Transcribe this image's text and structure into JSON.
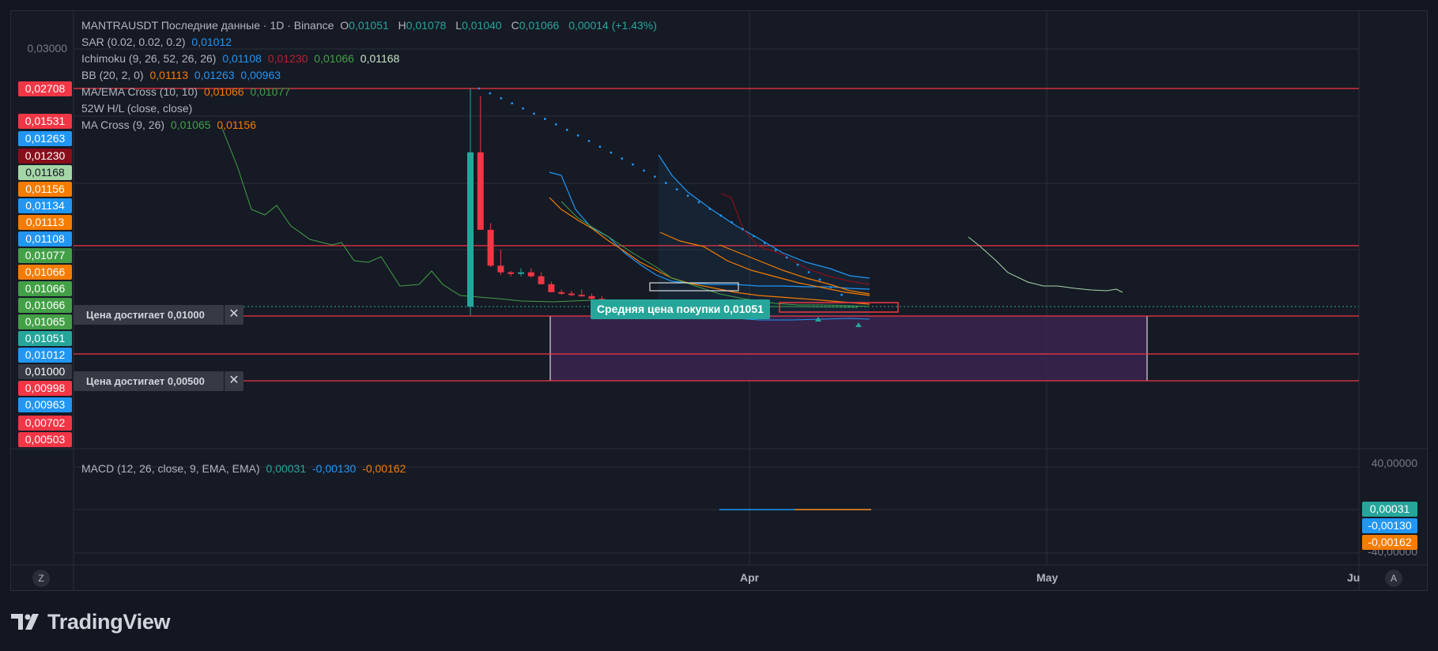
{
  "brand": {
    "name": "TradingView",
    "logo_icon": "tradingview-logo-icon"
  },
  "legend": {
    "main": {
      "symbol": "MANTRAUSDT Последние данные · 1D · Binance",
      "o_label": "O",
      "o": "0,01051",
      "h_label": "H",
      "h": "0,01078",
      "l_label": "L",
      "l": "0,01040",
      "c_label": "C",
      "c": "0,01066",
      "change": "0,00014 (+1.43%)"
    },
    "sar": {
      "label": "SAR (0.02, 0.02, 0.2)",
      "v1": "0,01012"
    },
    "ichimoku": {
      "label": "Ichimoku (9, 26, 52, 26, 26)",
      "v1": "0,01108",
      "v2": "0,01230",
      "v3": "0,01066",
      "v4": "0,01168"
    },
    "bb": {
      "label": "BB (20, 2, 0)",
      "v1": "0,01113",
      "v2": "0,01263",
      "v3": "0,00963"
    },
    "maema": {
      "label": "MA/EMA Cross (10, 10)",
      "v1": "0,01066",
      "v2": "0,01077"
    },
    "hl52": {
      "label": "52W H/L (close, close)"
    },
    "macross": {
      "label": "MA Cross (9, 26)",
      "v1": "0,01065",
      "v2": "0,01156"
    },
    "macd": {
      "label": "MACD (12, 26, close, 9, EMA, EMA)",
      "v1": "0,00031",
      "v2": "-0,00130",
      "v3": "-0,00162"
    }
  },
  "left_scale": {
    "ticks": [
      {
        "label": "0,03000",
        "value": 0.03
      }
    ],
    "tags": [
      {
        "label": "0,02708",
        "color": "#f23645"
      },
      {
        "label": "0,01531",
        "color": "#f23645"
      },
      {
        "label": "0,01263",
        "color": "#2196f3"
      },
      {
        "label": "0,01230",
        "color": "#880e1a"
      },
      {
        "label": "0,01168",
        "color": "#a5d6a7",
        "text": "#131722"
      },
      {
        "label": "0,01156",
        "color": "#f57c00"
      },
      {
        "label": "0,01134",
        "color": "#2196f3"
      },
      {
        "label": "0,01113",
        "color": "#f57c00"
      },
      {
        "label": "0,01108",
        "color": "#2196f3"
      },
      {
        "label": "0,01077",
        "color": "#43a047"
      },
      {
        "label": "0,01066",
        "color": "#f57c00"
      },
      {
        "label": "0,01066",
        "color": "#43a047"
      },
      {
        "label": "0,01066",
        "color": "#43a047"
      },
      {
        "label": "0,01065",
        "color": "#43a047"
      },
      {
        "label": "0,01051",
        "color": "#26a69a"
      },
      {
        "label": "0,01012",
        "color": "#2196f3"
      },
      {
        "label": "0,01000",
        "color": "#363a45"
      },
      {
        "label": "0,00998",
        "color": "#f23645"
      },
      {
        "label": "0,00963",
        "color": "#2196f3"
      },
      {
        "label": "0,00702",
        "color": "#f23645"
      },
      {
        "label": "0,00503",
        "color": "#f23645"
      }
    ]
  },
  "right_scale": {
    "ticks": [
      {
        "label": "40,00000"
      },
      {
        "label": "-40,00000"
      }
    ],
    "tags": [
      {
        "label": "0,00031",
        "color": "#26a69a"
      },
      {
        "label": "-0,00130",
        "color": "#2196f3"
      },
      {
        "label": "-0,00162",
        "color": "#f57c00"
      }
    ]
  },
  "alerts": [
    {
      "text": "Цена достигает 0,01000",
      "close_icon": "close-icon"
    },
    {
      "text": "Цена достигает 0,00500",
      "close_icon": "close-icon"
    }
  ],
  "avg_price_label": "Средняя цена покупки 0,01051",
  "x_axis": {
    "labels": [
      "Apr",
      "May",
      "Ju"
    ]
  },
  "corners": {
    "left": "Z",
    "right": "A"
  },
  "colors": {
    "up": "#26a69a",
    "down": "#f23645",
    "sar": "#2196f3",
    "bb": "#2196f3",
    "ema": "#f57c00",
    "purple_box": "#4a2a5a",
    "line_red": "#f23645"
  },
  "chart_data": {
    "type": "candlestick",
    "title": "MANTRAUSDT Последние данные · 1D · Binance",
    "x_ticks": [
      "Apr",
      "May",
      "Ju"
    ],
    "candles": [
      {
        "o": 0.0107,
        "h": 0.02708,
        "l": 0.01005,
        "c": 0.0223
      },
      {
        "o": 0.0223,
        "h": 0.0265,
        "l": 0.019,
        "c": 0.0165
      },
      {
        "o": 0.0165,
        "h": 0.017,
        "l": 0.0137,
        "c": 0.0138
      },
      {
        "o": 0.0138,
        "h": 0.015,
        "l": 0.0131,
        "c": 0.0133
      },
      {
        "o": 0.0133,
        "h": 0.0134,
        "l": 0.013,
        "c": 0.0132
      },
      {
        "o": 0.0132,
        "h": 0.0136,
        "l": 0.013,
        "c": 0.0133
      },
      {
        "o": 0.0133,
        "h": 0.0136,
        "l": 0.0129,
        "c": 0.013
      },
      {
        "o": 0.013,
        "h": 0.0133,
        "l": 0.0124,
        "c": 0.0124
      },
      {
        "o": 0.0124,
        "h": 0.0126,
        "l": 0.0118,
        "c": 0.0118
      },
      {
        "o": 0.0118,
        "h": 0.012,
        "l": 0.0116,
        "c": 0.0117
      },
      {
        "o": 0.0117,
        "h": 0.0119,
        "l": 0.0115,
        "c": 0.0116
      },
      {
        "o": 0.0116,
        "h": 0.012,
        "l": 0.0115,
        "c": 0.0115
      },
      {
        "o": 0.0115,
        "h": 0.0117,
        "l": 0.0112,
        "c": 0.0113
      },
      {
        "o": 0.0113,
        "h": 0.0115,
        "l": 0.0107,
        "c": 0.0108
      },
      {
        "o": 0.0108,
        "h": 0.011,
        "l": 0.0106,
        "c": 0.0109
      },
      {
        "o": 0.0109,
        "h": 0.0111,
        "l": 0.0107,
        "c": 0.0108
      },
      {
        "o": 0.0108,
        "h": 0.0109,
        "l": 0.0105,
        "c": 0.0106
      },
      {
        "o": 0.0106,
        "h": 0.0108,
        "l": 0.0103,
        "c": 0.0105
      },
      {
        "o": 0.0105,
        "h": 0.0106,
        "l": 0.0103,
        "c": 0.0104
      },
      {
        "o": 0.0104,
        "h": 0.0106,
        "l": 0.0102,
        "c": 0.0104
      },
      {
        "o": 0.0104,
        "h": 0.0107,
        "l": 0.0103,
        "c": 0.0105
      },
      {
        "o": 0.0105,
        "h": 0.0107,
        "l": 0.0104,
        "c": 0.0106
      },
      {
        "o": 0.0106,
        "h": 0.0107,
        "l": 0.0104,
        "c": 0.0105
      },
      {
        "o": 0.0105,
        "h": 0.0108,
        "l": 0.0103,
        "c": 0.0106
      },
      {
        "o": 0.0106,
        "h": 0.0107,
        "l": 0.0104,
        "c": 0.0105
      },
      {
        "o": 0.0105,
        "h": 0.0107,
        "l": 0.0104,
        "c": 0.0106
      },
      {
        "o": 0.01051,
        "h": 0.01078,
        "l": 0.0104,
        "c": 0.01066
      }
    ],
    "levels": [
      0.02708,
      0.01531,
      0.01,
      0.00702,
      0.00503
    ],
    "macd": {
      "macd": 0.00031,
      "signal": -0.0013,
      "histogram": -0.00162
    }
  }
}
